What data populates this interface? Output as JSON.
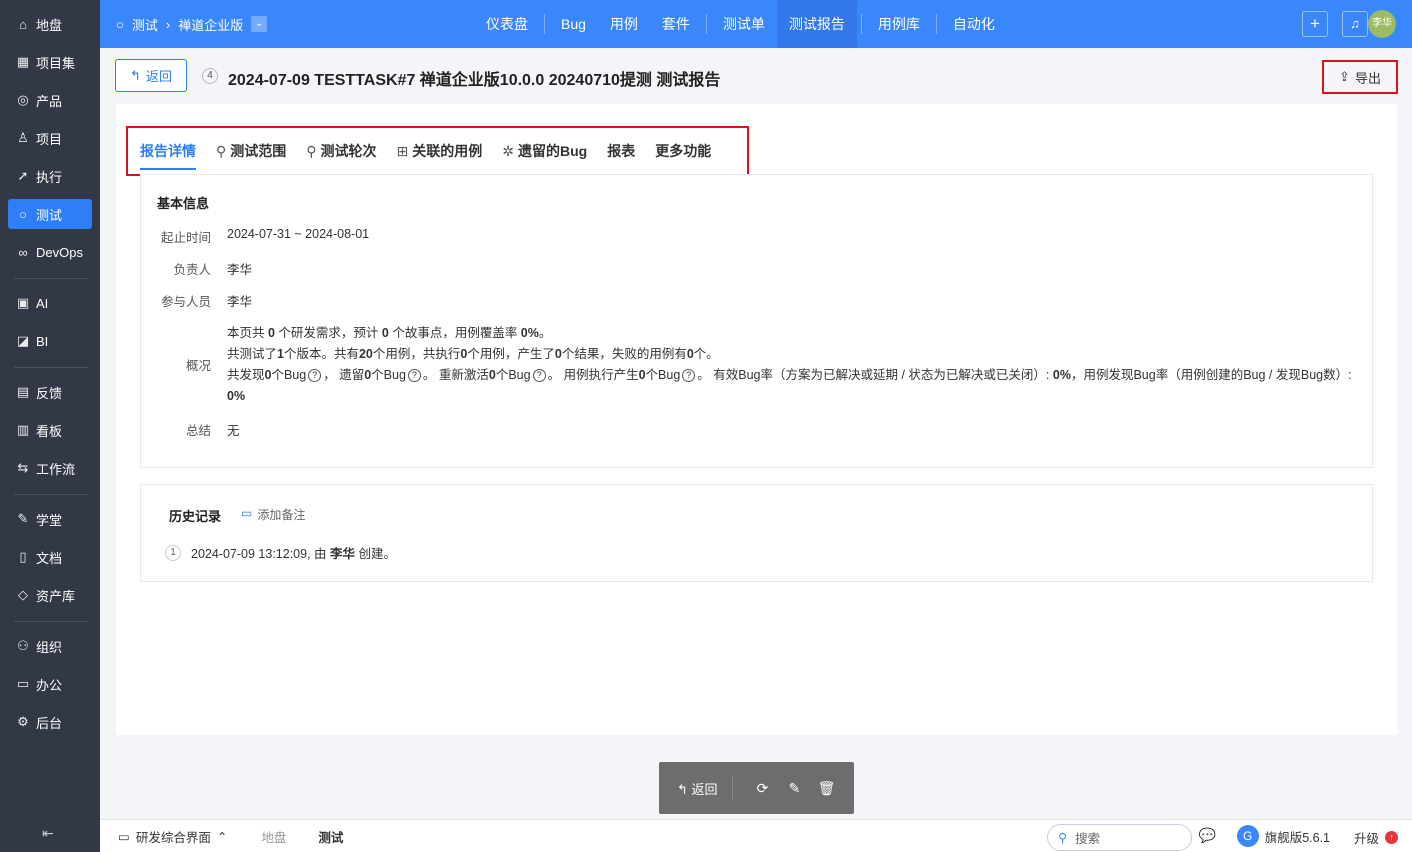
{
  "sidebar": {
    "items": [
      {
        "label": "地盘",
        "icon": "⌂"
      },
      {
        "label": "项目集",
        "icon": "▦"
      },
      {
        "label": "产品",
        "icon": "◎"
      },
      {
        "label": "项目",
        "icon": "♙"
      },
      {
        "label": "执行",
        "icon": "➚"
      },
      {
        "label": "测试",
        "icon": "○",
        "active": true
      },
      {
        "label": "DevOps",
        "icon": "∞"
      },
      {
        "label": "AI",
        "icon": "▣"
      },
      {
        "label": "BI",
        "icon": "◪"
      },
      {
        "label": "反馈",
        "icon": "▤"
      },
      {
        "label": "看板",
        "icon": "▥"
      },
      {
        "label": "工作流",
        "icon": "⇆"
      },
      {
        "label": "学堂",
        "icon": "✎"
      },
      {
        "label": "文档",
        "icon": "▯"
      },
      {
        "label": "资产库",
        "icon": "◇"
      },
      {
        "label": "组织",
        "icon": "⚇"
      },
      {
        "label": "办公",
        "icon": "▭"
      },
      {
        "label": "后台",
        "icon": "⚙"
      }
    ]
  },
  "topbar": {
    "module": "测试",
    "product": "禅道企业版",
    "nav": [
      "仪表盘",
      "Bug",
      "用例",
      "套件",
      "测试单",
      "测试报告",
      "用例库",
      "自动化"
    ],
    "active_nav": "测试报告",
    "avatar": "李华"
  },
  "header": {
    "back": "返回",
    "id": "4",
    "title": "2024-07-09 TESTTASK#7 禅道企业版10.0.0 20240710提测 测试报告",
    "export": "导出"
  },
  "tabs": [
    {
      "label": "报告详情",
      "icon": ""
    },
    {
      "label": "测试范围",
      "icon": "search"
    },
    {
      "label": "测试轮次",
      "icon": "search"
    },
    {
      "label": "关联的用例",
      "icon": "cases"
    },
    {
      "label": "遗留的Bug",
      "icon": "bug"
    },
    {
      "label": "报表",
      "icon": ""
    },
    {
      "label": "更多功能",
      "icon": ""
    }
  ],
  "info": {
    "heading": "基本信息",
    "fields": [
      {
        "label": "起止时间",
        "value": "2024-07-31 ~ 2024-08-01"
      },
      {
        "label": "负责人",
        "value": "李华"
      },
      {
        "label": "参与人员",
        "value": "李华"
      }
    ],
    "overview_label": "概况",
    "overview": [
      [
        [
          "本页共 ",
          0
        ],
        [
          "0",
          1
        ],
        [
          " 个研发需求，预计 ",
          0
        ],
        [
          "0",
          1
        ],
        [
          " 个故事点，用例覆盖率 ",
          0
        ],
        [
          "0%",
          1
        ],
        [
          "。",
          0
        ]
      ],
      [
        [
          "共测试了",
          0
        ],
        [
          "1",
          1
        ],
        [
          "个版本。共有",
          0
        ],
        [
          "20",
          1
        ],
        [
          "个用例，共执行",
          0
        ],
        [
          "0",
          1
        ],
        [
          "个用例，产生了",
          0
        ],
        [
          "0",
          1
        ],
        [
          "个结果，失败的用例有",
          0
        ],
        [
          "0",
          1
        ],
        [
          "个。",
          0
        ]
      ],
      [
        [
          "共发现",
          0
        ],
        [
          "0",
          1
        ],
        [
          "个Bug",
          0
        ],
        [
          "?",
          2
        ],
        [
          "，  遗留",
          0
        ],
        [
          "0",
          1
        ],
        [
          "个Bug",
          0
        ],
        [
          "?",
          2
        ],
        [
          "。  重新激活",
          0
        ],
        [
          "0",
          1
        ],
        [
          "个Bug",
          0
        ],
        [
          "?",
          2
        ],
        [
          "。  用例执行产生",
          0
        ],
        [
          "0",
          1
        ],
        [
          "个Bug",
          0
        ],
        [
          "?",
          2
        ],
        [
          "。  有效Bug率（方案为已解决或延期 / 状态为已解决或已关闭）: ",
          0
        ],
        [
          "0%",
          1
        ],
        [
          "，用例发现Bug率（用例创建的Bug / 发现Bug数）: ",
          0
        ],
        [
          "0%",
          1
        ]
      ]
    ],
    "summary_label": "总结",
    "summary": "无"
  },
  "history": {
    "heading": "历史记录",
    "add_note": "添加备注",
    "items": [
      {
        "num": "1",
        "pre": "2024-07-09 13:12:09, 由 ",
        "user": "李华",
        "post": " 创建。"
      }
    ]
  },
  "actions": {
    "back": "返回"
  },
  "footer": {
    "app": "研发综合界面",
    "crumbs": [
      "地盘",
      "测试"
    ],
    "search": "搜索",
    "version": "旗舰版5.6.1",
    "upgrade": "升级"
  }
}
